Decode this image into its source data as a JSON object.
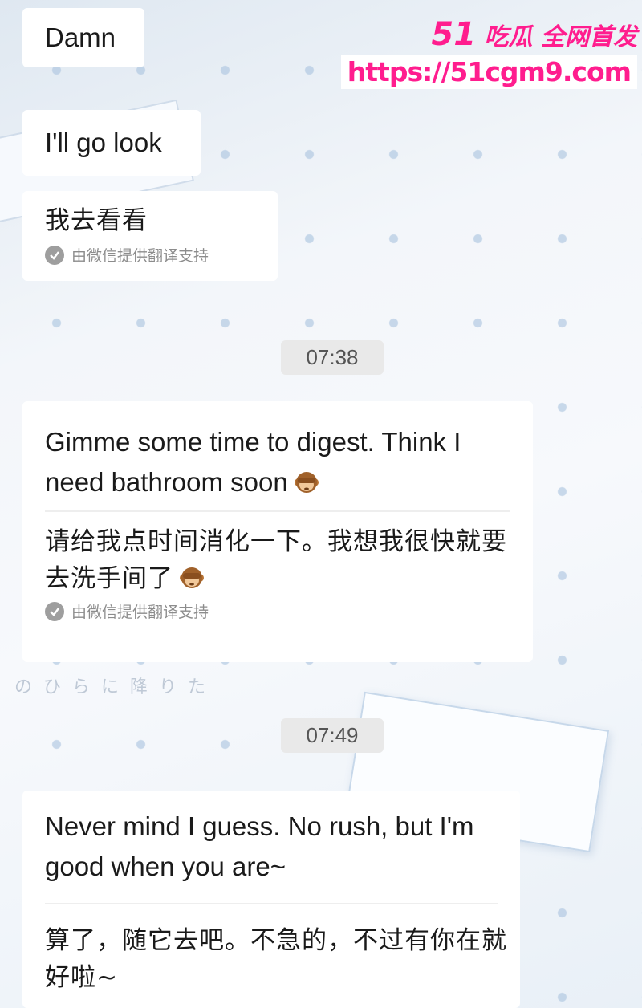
{
  "watermark": {
    "brand_num": "51",
    "brand_text": "吃瓜 全网首发",
    "url": "https://51cgm9.com"
  },
  "decor_text": "のひらに降りた",
  "messages": [
    {
      "id": "m1",
      "text": "Damn"
    },
    {
      "id": "m2",
      "text": "I'll go look",
      "translation": "我去看看",
      "translation_note": "由微信提供翻译支持"
    },
    {
      "id": "t1",
      "time": "07:38"
    },
    {
      "id": "m3",
      "text": "Gimme some time to digest. Think I need bathroom soon",
      "emoji": "see-no-evil-monkey",
      "translation": "请给我点时间消化一下。我想我很快就要去洗手间了",
      "translation_note": "由微信提供翻译支持"
    },
    {
      "id": "t2",
      "time": "07:49"
    },
    {
      "id": "m4",
      "text": "Never mind I guess. No rush, but I'm good when you are~",
      "translation": "算了，随它去吧。不急的，不过有你在就好啦~"
    }
  ],
  "colors": {
    "bubble": "#ffffff",
    "brand": "#ff1d8e",
    "note_gray": "#8c8c8c"
  }
}
